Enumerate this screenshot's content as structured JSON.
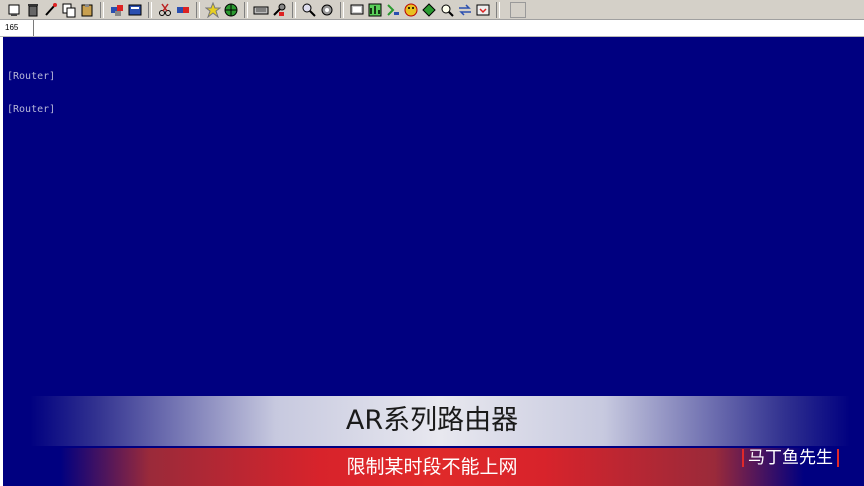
{
  "toolbar": {
    "groups": [
      [
        "new-session",
        "delete",
        "connect",
        "copy",
        "paste"
      ],
      [
        "hosts",
        "properties"
      ],
      [
        "cut",
        "link"
      ],
      [
        "star",
        "globe"
      ],
      [
        "keyboard",
        "tools"
      ],
      [
        "zoom",
        "settings"
      ],
      [
        "monitor",
        "chart",
        "script",
        "smiley",
        "arrow",
        "find",
        "transfer",
        "help"
      ]
    ]
  },
  "tab": {
    "label": "165"
  },
  "terminal": {
    "lines": [
      "[Router]",
      "[Router]"
    ],
    "background": "#000080",
    "text_color": "#b8b8d8"
  },
  "caption": {
    "title": "AR系列路由器",
    "subtitle": "限制某时段不能上网"
  },
  "watermark": {
    "text": "马丁鱼先生"
  }
}
